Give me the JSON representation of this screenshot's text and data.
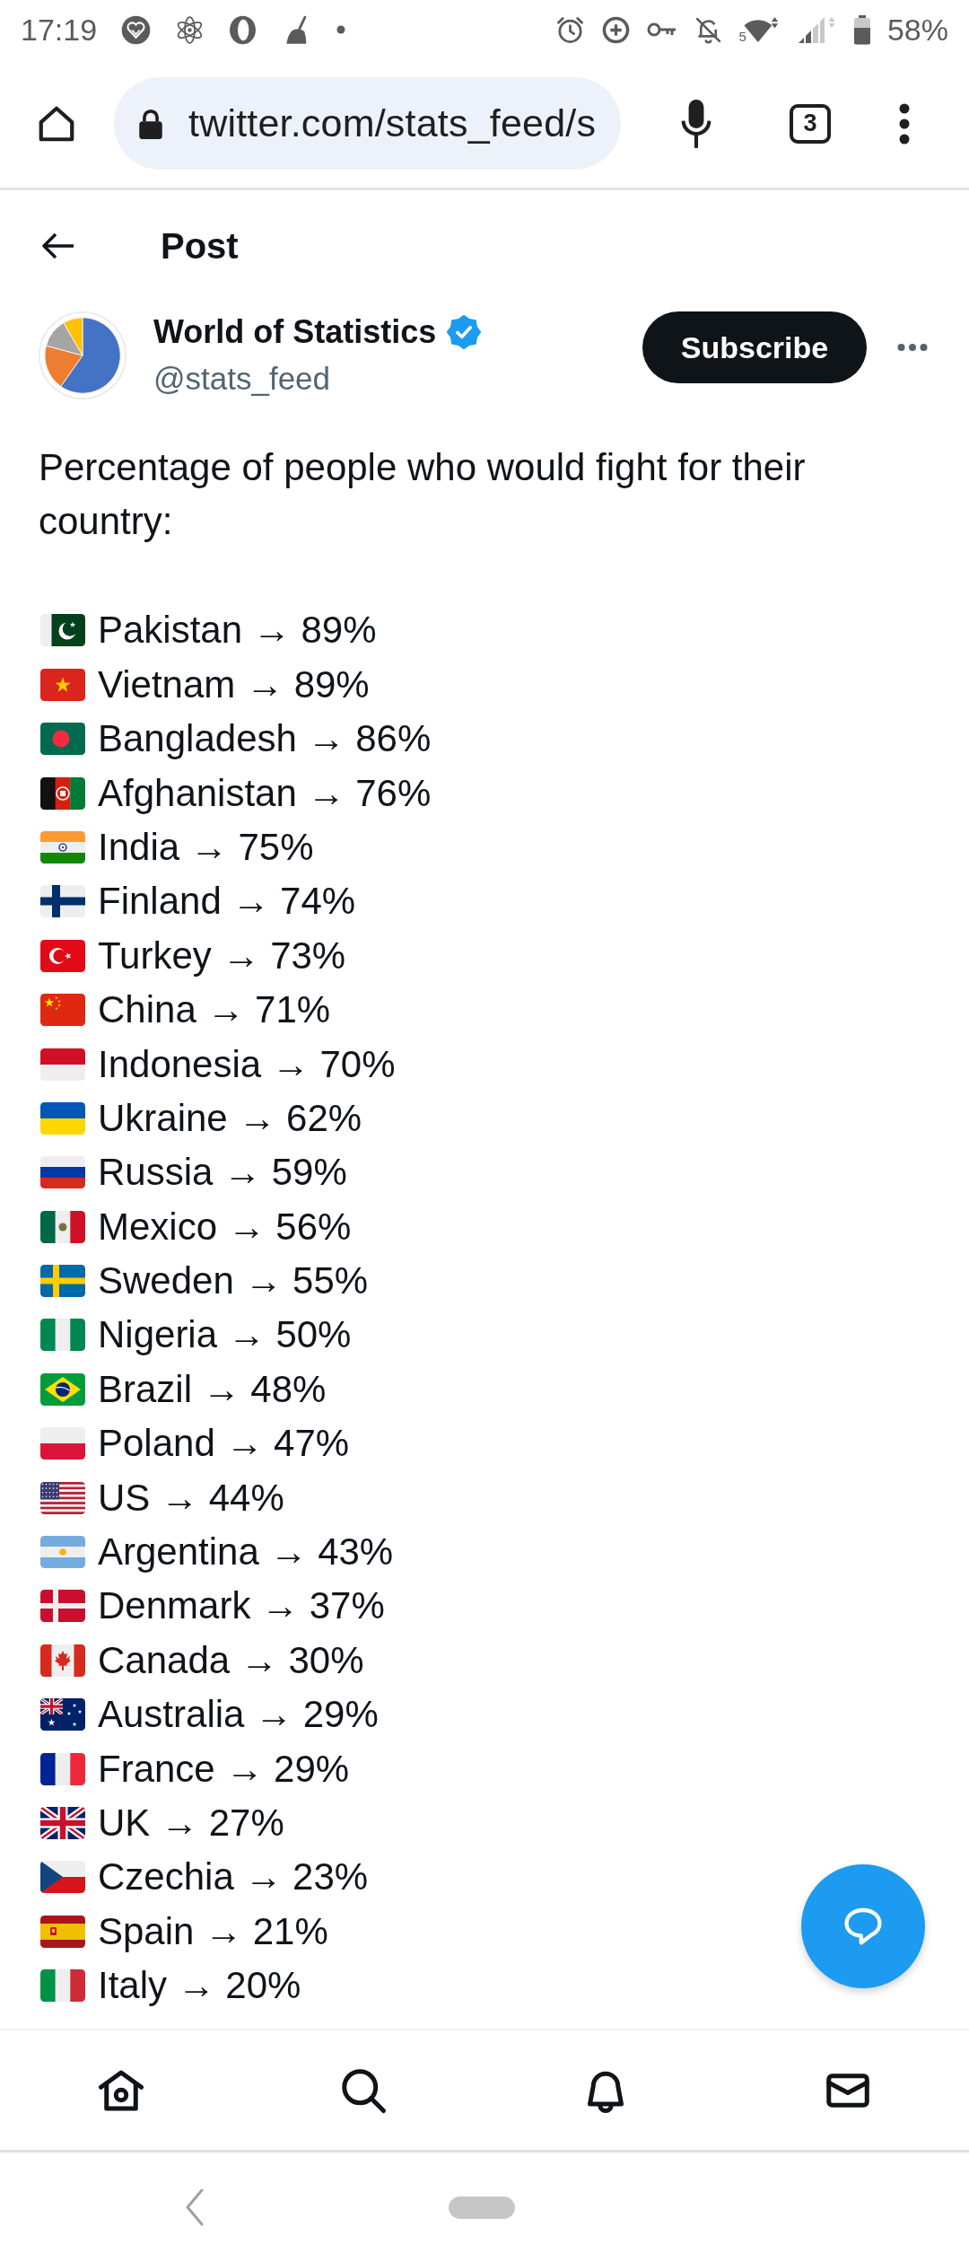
{
  "status_bar": {
    "time": "17:19",
    "wifi_label": "5",
    "battery": "58%"
  },
  "browser": {
    "url": "twitter.com/stats_feed/s",
    "tab_count": "3"
  },
  "header": {
    "title": "Post"
  },
  "post": {
    "author": {
      "name": "World of Statistics",
      "handle": "@stats_feed",
      "verified": true
    },
    "subscribe": "Subscribe",
    "text": "Percentage of people who would fight for their country:",
    "items": [
      {
        "kind": "pk",
        "text": "Pakistan → 89%"
      },
      {
        "kind": "vn",
        "text": "Vietnam → 89%"
      },
      {
        "kind": "bd",
        "text": "Bangladesh → 86%"
      },
      {
        "kind": "af",
        "text": "Afghanistan → 76%"
      },
      {
        "kind": "in",
        "text": "India → 75%"
      },
      {
        "kind": "fi",
        "text": "Finland → 74%"
      },
      {
        "kind": "tr",
        "text": "Turkey → 73%"
      },
      {
        "kind": "cn",
        "text": "China → 71%"
      },
      {
        "kind": "id",
        "text": "Indonesia → 70%"
      },
      {
        "kind": "ua",
        "text": "Ukraine → 62%"
      },
      {
        "kind": "ru",
        "text": "Russia → 59%"
      },
      {
        "kind": "mx",
        "text": "Mexico → 56%"
      },
      {
        "kind": "se",
        "text": "Sweden → 55%"
      },
      {
        "kind": "ng",
        "text": "Nigeria → 50%"
      },
      {
        "kind": "br",
        "text": "Brazil → 48%"
      },
      {
        "kind": "pl",
        "text": "Poland → 47%"
      },
      {
        "kind": "us",
        "text": "US → 44%"
      },
      {
        "kind": "ar",
        "text": "Argentina → 43%"
      },
      {
        "kind": "dk",
        "text": "Denmark → 37%"
      },
      {
        "kind": "ca",
        "text": "Canada → 30%"
      },
      {
        "kind": "au",
        "text": "Australia → 29%"
      },
      {
        "kind": "fr",
        "text": "France → 29%"
      },
      {
        "kind": "gb",
        "text": "UK → 27%"
      },
      {
        "kind": "cz",
        "text": "Czechia → 23%"
      },
      {
        "kind": "es",
        "text": "Spain → 21%"
      },
      {
        "kind": "it",
        "text": "Italy → 20%"
      }
    ]
  },
  "bottom_nav": [
    {
      "kind": "home",
      "selected": false
    },
    {
      "kind": "search",
      "selected": false
    },
    {
      "kind": "notifications",
      "selected": false
    },
    {
      "kind": "messages",
      "selected": false
    }
  ]
}
